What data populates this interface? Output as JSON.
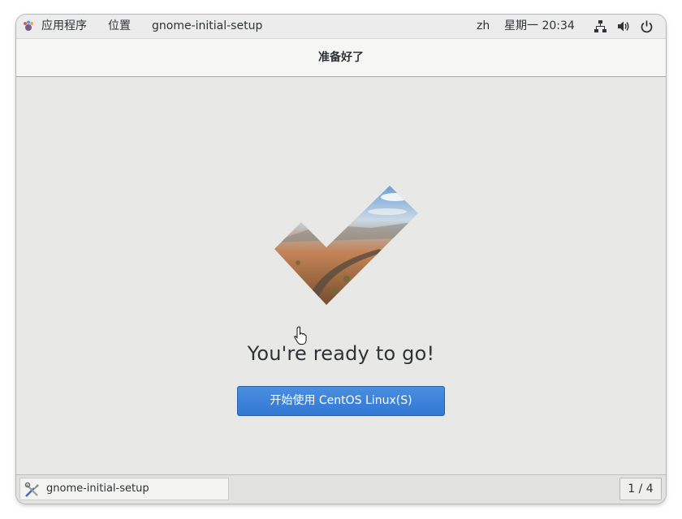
{
  "top_panel": {
    "applications": "应用程序",
    "places": "位置",
    "active_app": "gnome-initial-setup",
    "input_method": "zh",
    "clock": "星期一 20:34"
  },
  "header": {
    "title": "准备好了"
  },
  "main": {
    "ready_text": "You're ready to go!",
    "start_button": "开始使用  CentOS Linux(S)"
  },
  "taskbar": {
    "task_label": "gnome-initial-setup",
    "workspace": "1 / 4"
  },
  "icons": {
    "apps": "gnome-foot-icon",
    "network": "network-wired-icon",
    "volume": "speaker-volume-icon",
    "power": "power-icon",
    "checkmark": "checkmark-landscape-icon",
    "task": "setup-tools-icon",
    "cursor": "hand-pointer-icon"
  },
  "colors": {
    "accent": "#3a82db",
    "background": "#e8e8e7",
    "text": "#2e3436"
  }
}
